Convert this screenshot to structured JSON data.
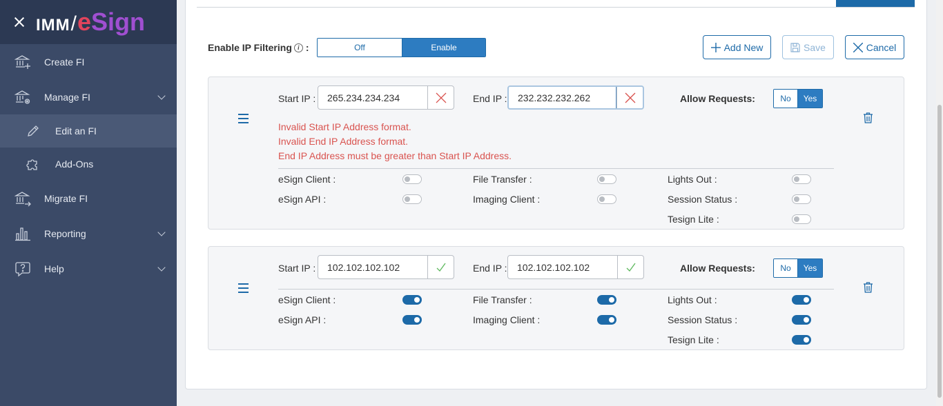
{
  "brand": {
    "imm": "IMM",
    "slash": "/",
    "e": "e",
    "sign": "Sign"
  },
  "sidebar": {
    "items": [
      {
        "label": "Create FI",
        "icon": "bank-plus-icon"
      },
      {
        "label": "Manage FI",
        "icon": "bank-gear-icon"
      },
      {
        "label": "Edit an FI",
        "icon": "pencil-icon"
      },
      {
        "label": "Add-Ons",
        "icon": "puzzle-icon"
      },
      {
        "label": "Migrate FI",
        "icon": "bank-arrow-icon"
      },
      {
        "label": "Reporting",
        "icon": "bar-chart-icon"
      },
      {
        "label": "Help",
        "icon": "question-bubble-icon"
      }
    ]
  },
  "ip_filtering": {
    "label": "Enable IP Filtering",
    "colon": ":",
    "off_label": "Off",
    "enable_label": "Enable",
    "selected": "Enable"
  },
  "actions": {
    "add_new": "Add New",
    "save": "Save",
    "cancel": "Cancel"
  },
  "rules": [
    {
      "start_label": "Start IP :",
      "start_ip": "265.234.234.234",
      "start_status": "invalid",
      "end_label": "End IP :",
      "end_ip": "232.232.232.262",
      "end_status": "invalid",
      "allow_label": "Allow Requests:",
      "allow_no": "No",
      "allow_yes": "Yes",
      "allow_selected": "Yes",
      "errors": [
        "Invalid Start IP Address format.",
        "Invalid End IP Address format.",
        "End IP Address must be greater than Start IP Address."
      ],
      "services": {
        "esign_client": {
          "label": "eSign Client :",
          "on": false
        },
        "esign_api": {
          "label": "eSign API :",
          "on": false
        },
        "file_transfer": {
          "label": "File Transfer :",
          "on": false
        },
        "imaging_client": {
          "label": "Imaging Client :",
          "on": false
        },
        "lights_out": {
          "label": "Lights Out :",
          "on": false
        },
        "session_status": {
          "label": "Session Status :",
          "on": false
        },
        "tesign_lite": {
          "label": "Tesign Lite :",
          "on": false
        }
      }
    },
    {
      "start_label": "Start IP :",
      "start_ip": "102.102.102.102",
      "start_status": "valid",
      "end_label": "End IP :",
      "end_ip": "102.102.102.102",
      "end_status": "valid",
      "allow_label": "Allow Requests:",
      "allow_no": "No",
      "allow_yes": "Yes",
      "allow_selected": "Yes",
      "errors": [],
      "services": {
        "esign_client": {
          "label": "eSign Client :",
          "on": true
        },
        "esign_api": {
          "label": "eSign API :",
          "on": true
        },
        "file_transfer": {
          "label": "File Transfer :",
          "on": true
        },
        "imaging_client": {
          "label": "Imaging Client :",
          "on": true
        },
        "lights_out": {
          "label": "Lights Out :",
          "on": true
        },
        "session_status": {
          "label": "Session Status :",
          "on": true
        },
        "tesign_lite": {
          "label": "Tesign Lite :",
          "on": true
        }
      }
    }
  ],
  "colors": {
    "sidebar": "#3b4a67",
    "brand_bar": "#2c3953",
    "accent": "#1d6aa8",
    "error": "#d9534f",
    "valid": "#5cb85c"
  }
}
